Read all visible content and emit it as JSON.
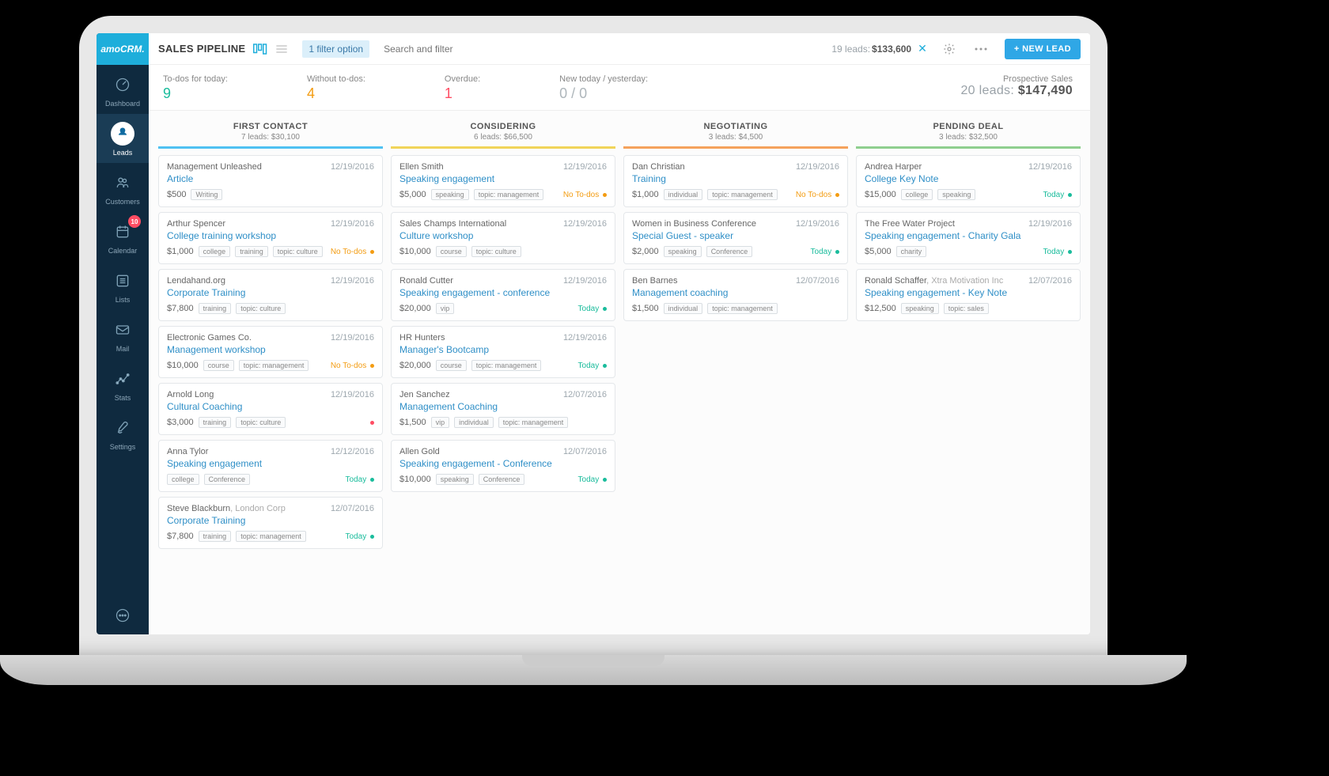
{
  "brand": "amoCRM.",
  "nav": [
    {
      "key": "dashboard",
      "label": "Dashboard"
    },
    {
      "key": "leads",
      "label": "Leads",
      "active": true
    },
    {
      "key": "customers",
      "label": "Customers"
    },
    {
      "key": "calendar",
      "label": "Calendar",
      "badge": "10"
    },
    {
      "key": "lists",
      "label": "Lists"
    },
    {
      "key": "mail",
      "label": "Mail"
    },
    {
      "key": "stats",
      "label": "Stats"
    },
    {
      "key": "settings",
      "label": "Settings"
    }
  ],
  "header": {
    "title": "SALES PIPELINE",
    "filter_chip": "1 filter option",
    "search_placeholder": "Search and filter",
    "summary_count": "19 leads:",
    "summary_total": "$133,600",
    "new_lead": "+ NEW LEAD"
  },
  "stats": {
    "todos_label": "To-dos for today:",
    "todos_val": "9",
    "without_label": "Without to-dos:",
    "without_val": "4",
    "overdue_label": "Overdue:",
    "overdue_val": "1",
    "newtoday_label": "New today / yesterday:",
    "newtoday_val": "0 / 0",
    "prospective_label": "Prospective Sales",
    "prospective_count": "20 leads:",
    "prospective_total": "$147,490"
  },
  "columns": [
    {
      "title": "FIRST CONTACT",
      "sub": "7 leads: $30,100",
      "accent": "blue",
      "cards": [
        {
          "name": "Management Unleashed",
          "date": "12/19/2016",
          "link": "Article",
          "amount": "$500",
          "tags": [
            "Writing"
          ]
        },
        {
          "name": "Arthur Spencer",
          "date": "12/19/2016",
          "link": "College training workshop",
          "amount": "$1,000",
          "tags": [
            "college",
            "training",
            "topic: culture"
          ],
          "todo": "No To-dos",
          "todo_type": "no"
        },
        {
          "name": "Lendahand.org",
          "date": "12/19/2016",
          "link": "Corporate Training",
          "amount": "$7,800",
          "tags": [
            "training",
            "topic: culture"
          ]
        },
        {
          "name": "Electronic Games Co.",
          "date": "12/19/2016",
          "link": "Management workshop",
          "amount": "$10,000",
          "tags": [
            "course",
            "topic: management"
          ],
          "todo": "No To-dos",
          "todo_type": "no"
        },
        {
          "name": "Arnold Long",
          "date": "12/19/2016",
          "link": "Cultural Coaching",
          "amount": "$3,000",
          "tags": [
            "training",
            "topic: culture"
          ],
          "todo_type": "red-dot"
        },
        {
          "name": "Anna Tylor",
          "date": "12/12/2016",
          "link": "Speaking engagement",
          "amount": "",
          "tags": [
            "college",
            "Conference"
          ],
          "todo": "Today",
          "todo_type": "today"
        },
        {
          "name": "Steve Blackburn",
          "company": "London Corp",
          "date": "12/07/2016",
          "link": "Corporate Training",
          "amount": "$7,800",
          "tags": [
            "training",
            "topic: management"
          ],
          "todo": "Today",
          "todo_type": "today"
        }
      ]
    },
    {
      "title": "CONSIDERING",
      "sub": "6 leads: $66,500",
      "accent": "yellow",
      "cards": [
        {
          "name": "Ellen Smith",
          "date": "12/19/2016",
          "link": "Speaking engagement",
          "amount": "$5,000",
          "tags": [
            "speaking",
            "topic: management"
          ],
          "todo": "No To-dos",
          "todo_type": "no"
        },
        {
          "name": "Sales Champs International",
          "date": "12/19/2016",
          "link": "Culture workshop",
          "amount": "$10,000",
          "tags": [
            "course",
            "topic: culture"
          ]
        },
        {
          "name": "Ronald Cutter",
          "date": "12/19/2016",
          "link": "Speaking engagement - conference",
          "amount": "$20,000",
          "tags": [
            "vip"
          ],
          "todo": "Today",
          "todo_type": "today"
        },
        {
          "name": "HR Hunters",
          "date": "12/19/2016",
          "link": "Manager's Bootcamp",
          "amount": "$20,000",
          "tags": [
            "course",
            "topic: management"
          ],
          "todo": "Today",
          "todo_type": "today"
        },
        {
          "name": "Jen Sanchez",
          "date": "12/07/2016",
          "link": "Management Coaching",
          "amount": "$1,500",
          "tags": [
            "vip",
            "individual",
            "topic: management"
          ]
        },
        {
          "name": "Allen Gold",
          "date": "12/07/2016",
          "link": "Speaking engagement - Conference",
          "amount": "$10,000",
          "tags": [
            "speaking",
            "Conference"
          ],
          "todo": "Today",
          "todo_type": "today"
        }
      ]
    },
    {
      "title": "NEGOTIATING",
      "sub": "3 leads: $4,500",
      "accent": "orange",
      "cards": [
        {
          "name": "Dan Christian",
          "date": "12/19/2016",
          "link": "Training",
          "amount": "$1,000",
          "tags": [
            "individual",
            "topic: management"
          ],
          "todo": "No To-dos",
          "todo_type": "no"
        },
        {
          "name": "Women in Business Conference",
          "date": "12/19/2016",
          "link": "Special Guest - speaker",
          "amount": "$2,000",
          "tags": [
            "speaking",
            "Conference"
          ],
          "todo": "Today",
          "todo_type": "today"
        },
        {
          "name": "Ben Barnes",
          "date": "12/07/2016",
          "link": "Management coaching",
          "amount": "$1,500",
          "tags": [
            "individual",
            "topic: management"
          ]
        }
      ]
    },
    {
      "title": "PENDING DEAL",
      "sub": "3 leads: $32,500",
      "accent": "green",
      "cards": [
        {
          "name": "Andrea Harper",
          "date": "12/19/2016",
          "link": "College Key Note",
          "amount": "$15,000",
          "tags": [
            "college",
            "speaking"
          ],
          "todo": "Today",
          "todo_type": "today"
        },
        {
          "name": "The Free Water Project",
          "date": "12/19/2016",
          "link": "Speaking engagement - Charity Gala",
          "amount": "$5,000",
          "tags": [
            "charity"
          ],
          "todo": "Today",
          "todo_type": "today"
        },
        {
          "name": "Ronald Schaffer",
          "company": "Xtra Motivation Inc",
          "date": "12/07/2016",
          "link": "Speaking engagement - Key Note",
          "amount": "$12,500",
          "tags": [
            "speaking",
            "topic: sales"
          ]
        }
      ]
    }
  ]
}
